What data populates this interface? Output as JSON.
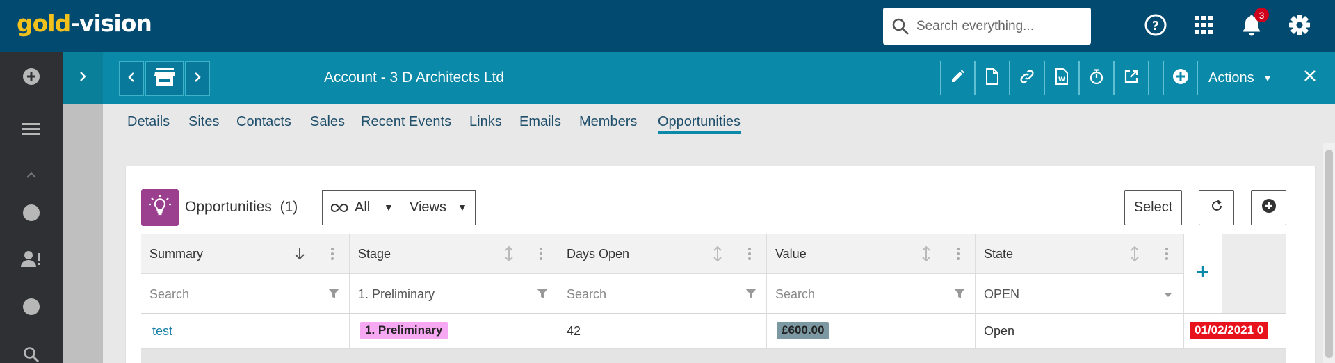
{
  "app": {
    "logo_part1": "gold",
    "logo_part2": "-vision",
    "search_placeholder": "Search everything...",
    "notification_count": "3"
  },
  "record": {
    "title": "Account - 3 D Architects Ltd",
    "actions_label": "Actions"
  },
  "tabs": [
    {
      "label": "Details"
    },
    {
      "label": "Sites"
    },
    {
      "label": "Contacts"
    },
    {
      "label": "Sales"
    },
    {
      "label": "Recent Events"
    },
    {
      "label": "Links"
    },
    {
      "label": "Emails"
    },
    {
      "label": "Members"
    },
    {
      "label": "Opportunities",
      "active": true
    }
  ],
  "panel": {
    "title": "Opportunities",
    "count": "(1)",
    "filter_all": "All",
    "views": "Views",
    "select": "Select"
  },
  "grid": {
    "columns": [
      {
        "label": "Summary",
        "filter_placeholder": "Search",
        "filter_value": ""
      },
      {
        "label": "Stage",
        "filter_placeholder": "",
        "filter_value": "1. Preliminary"
      },
      {
        "label": "Days Open",
        "filter_placeholder": "Search",
        "filter_value": ""
      },
      {
        "label": "Value",
        "filter_placeholder": "Search",
        "filter_value": ""
      },
      {
        "label": "State",
        "filter_placeholder": "",
        "filter_value": "OPEN"
      }
    ],
    "rows": [
      {
        "summary": "test",
        "stage": "1. Preliminary",
        "days_open": "42",
        "value": "£600.00",
        "state": "Open",
        "date": "01/02/2021 0"
      }
    ]
  },
  "colors": {
    "topbar": "#034a70",
    "teal": "#0a8aa8",
    "stage_pill": "#f7a8f2",
    "value_pill": "#7c98a2",
    "date_pill": "#e8121d",
    "opp_icon_bg": "#9b3f8f"
  },
  "icons": [
    "search-icon",
    "help-icon",
    "apps-grid-icon",
    "bell-icon",
    "gear-icon",
    "add-circle-icon",
    "menu-icon",
    "chevron-up-icon",
    "circle-icon",
    "user-alert-icon",
    "search-icon",
    "chevron-right-icon",
    "chevron-left-icon",
    "store-icon",
    "edit-icon",
    "document-icon",
    "link-icon",
    "word-doc-icon",
    "timer-icon",
    "external-link-icon",
    "plus-circle-icon",
    "close-icon",
    "lightbulb-icon",
    "infinity-icon",
    "refresh-icon",
    "sort-down-icon",
    "sort-icon",
    "kebab-icon",
    "filter-icon",
    "plus-icon"
  ]
}
